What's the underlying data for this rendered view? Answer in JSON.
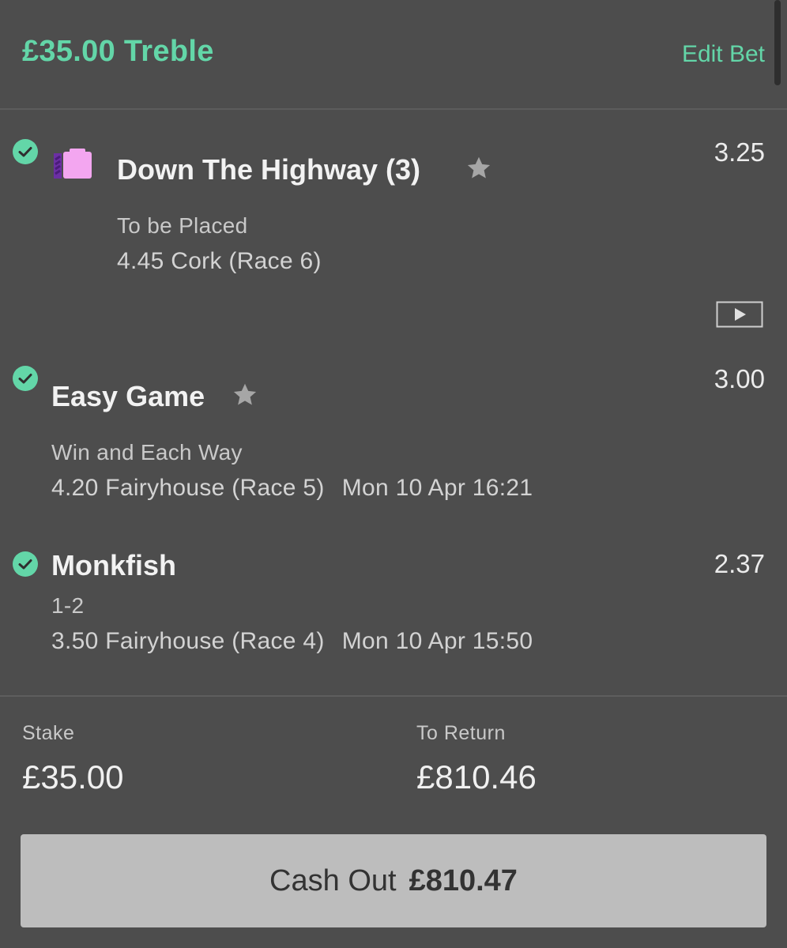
{
  "header": {
    "title": "£35.00 Treble",
    "edit_label": "Edit Bet"
  },
  "selections": [
    {
      "name": "Down The Highway (3)",
      "odds": "3.25",
      "market": "To be Placed",
      "race": "4.45 Cork (Race 6)",
      "time": "",
      "status": "won"
    },
    {
      "name": "Easy Game",
      "odds": "3.00",
      "market": "Win and Each Way",
      "race": "4.20 Fairyhouse (Race 5)",
      "time": "Mon 10 Apr 16:21",
      "status": "won"
    },
    {
      "name": "Monkfish",
      "odds": "2.37",
      "market": "1-2",
      "race": "3.50 Fairyhouse (Race 4)",
      "time": "Mon 10 Apr 15:50",
      "status": "won"
    }
  ],
  "summary": {
    "stake_label": "Stake",
    "stake_value": "£35.00",
    "return_label": "To Return",
    "return_value": "£810.46"
  },
  "cashout": {
    "label": "Cash Out",
    "amount": "£810.47"
  },
  "colors": {
    "accent": "#63d6a8",
    "background": "#4d4d4d",
    "button": "#bdbdbd",
    "silks_primary": "#f3a6f0",
    "silks_secondary": "#6b2fa3"
  },
  "icons": [
    "check-icon",
    "silks-icon",
    "star-icon",
    "video-icon"
  ]
}
